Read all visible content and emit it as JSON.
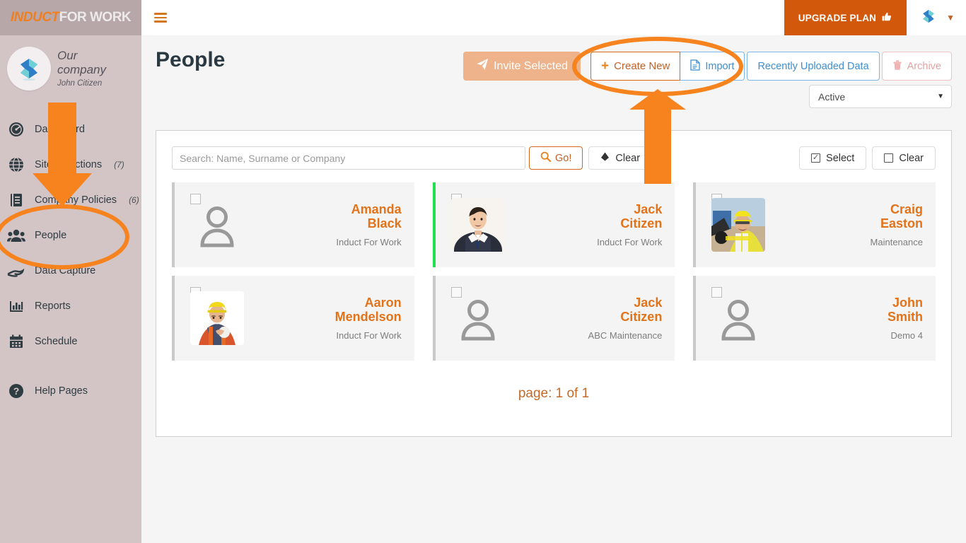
{
  "brand": {
    "part1": "INDUCT",
    "part2": "FOR WORK"
  },
  "company": {
    "name": "Our company",
    "user": "John Citizen",
    "avatar_icon": "company-logo-icon"
  },
  "sidebar": {
    "items": [
      {
        "label": "Dashboard",
        "count": "",
        "icon": "dashboard-icon"
      },
      {
        "label": "Site Inductions",
        "count": "(7)",
        "icon": "globe-icon"
      },
      {
        "label": "Company Policies",
        "count": "(6)",
        "icon": "book-icon"
      },
      {
        "label": "People",
        "count": "",
        "icon": "people-icon"
      },
      {
        "label": "Data Capture",
        "count": "",
        "icon": "hand-icon"
      },
      {
        "label": "Reports",
        "count": "",
        "icon": "bar-chart-icon"
      },
      {
        "label": "Schedule",
        "count": "",
        "icon": "calendar-icon"
      },
      {
        "label": "Help Pages",
        "count": "",
        "icon": "question-circle-icon"
      }
    ]
  },
  "topbar": {
    "menu_icon": "hamburger-icon",
    "upgrade_label": "UPGRADE PLAN",
    "upgrade_icon": "thumbs-up-icon",
    "user_avatar_icon": "user-logo-icon",
    "caret_icon": "chevron-down-icon"
  },
  "header": {
    "title": "People",
    "invite_label": "Invite Selected",
    "create_label": "Create New",
    "import_label": "Import",
    "recent_label": "Recently Uploaded Data",
    "archive_label": "Archive",
    "status_value": "Active"
  },
  "toolbar": {
    "search_placeholder": "Search: Name, Surname or Company",
    "search_value": "",
    "go_label": "Go!",
    "clear_label": "Clear",
    "select_label": "Select",
    "clear_sel_label": "Clear"
  },
  "people": [
    {
      "name_first": "Amanda",
      "name_last": "Black",
      "org": "Induct For Work",
      "photo": "placeholder",
      "status": "none"
    },
    {
      "name_first": "Jack",
      "name_last": "Citizen",
      "org": "Induct For Work",
      "photo": "man-suit",
      "status": "green"
    },
    {
      "name_first": "Craig",
      "name_last": "Easton",
      "org": "Maintenance",
      "photo": "worker-excavator",
      "status": "none"
    },
    {
      "name_first": "Aaron",
      "name_last": "Mendelson",
      "org": "Induct For Work",
      "photo": "worker-hardhat",
      "status": "none"
    },
    {
      "name_first": "Jack",
      "name_last": "Citizen",
      "org": "ABC Maintenance",
      "photo": "placeholder",
      "status": "none"
    },
    {
      "name_first": "John",
      "name_last": "Smith",
      "org": "Demo 4",
      "photo": "placeholder",
      "status": "none"
    }
  ],
  "pager": {
    "text": "page: 1 of 1"
  },
  "colors": {
    "accent_orange": "#e8831d",
    "annotation_orange": "#f7831f",
    "upgrade_bg": "#d2590b",
    "sidebar_bg": "#d3c4c6",
    "brand_bg": "#b7a7a9",
    "active_green": "#22e04e"
  },
  "annotations": {
    "sidebar_arrow": "down-arrow-annotation",
    "people_ellipse": "people-highlight-ellipse",
    "create_new_ellipse": "create-new-highlight-ellipse",
    "create_new_arrow": "up-arrow-annotation"
  }
}
